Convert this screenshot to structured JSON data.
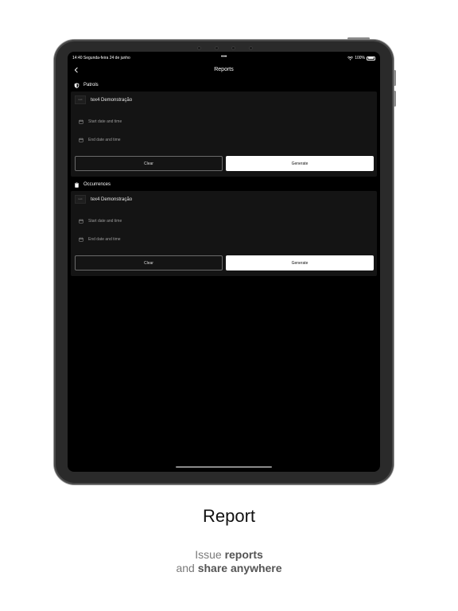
{
  "status_bar": {
    "time": "14:40",
    "date": "Segunda-feira 24 de junho",
    "dots": "•••",
    "battery": "100%"
  },
  "nav": {
    "title": "Reports"
  },
  "sections": [
    {
      "title": "Patrols",
      "icon": "shield-icon",
      "company": "tex4 Demonstração",
      "company_thumb": "tex4",
      "start_placeholder": "Start date and time",
      "end_placeholder": "End date and time",
      "clear_label": "Clear",
      "generate_label": "Generate"
    },
    {
      "title": "Occurrences",
      "icon": "clipboard-icon",
      "company": "tex4 Demonstração",
      "company_thumb": "tex4",
      "start_placeholder": "Start date and time",
      "end_placeholder": "End date and time",
      "clear_label": "Clear",
      "generate_label": "Generate"
    }
  ],
  "caption": {
    "title": "Report",
    "line1_plain": "Issue ",
    "line1_bold": "reports",
    "line2_plain": "and ",
    "line2_bold": "share anywhere"
  }
}
